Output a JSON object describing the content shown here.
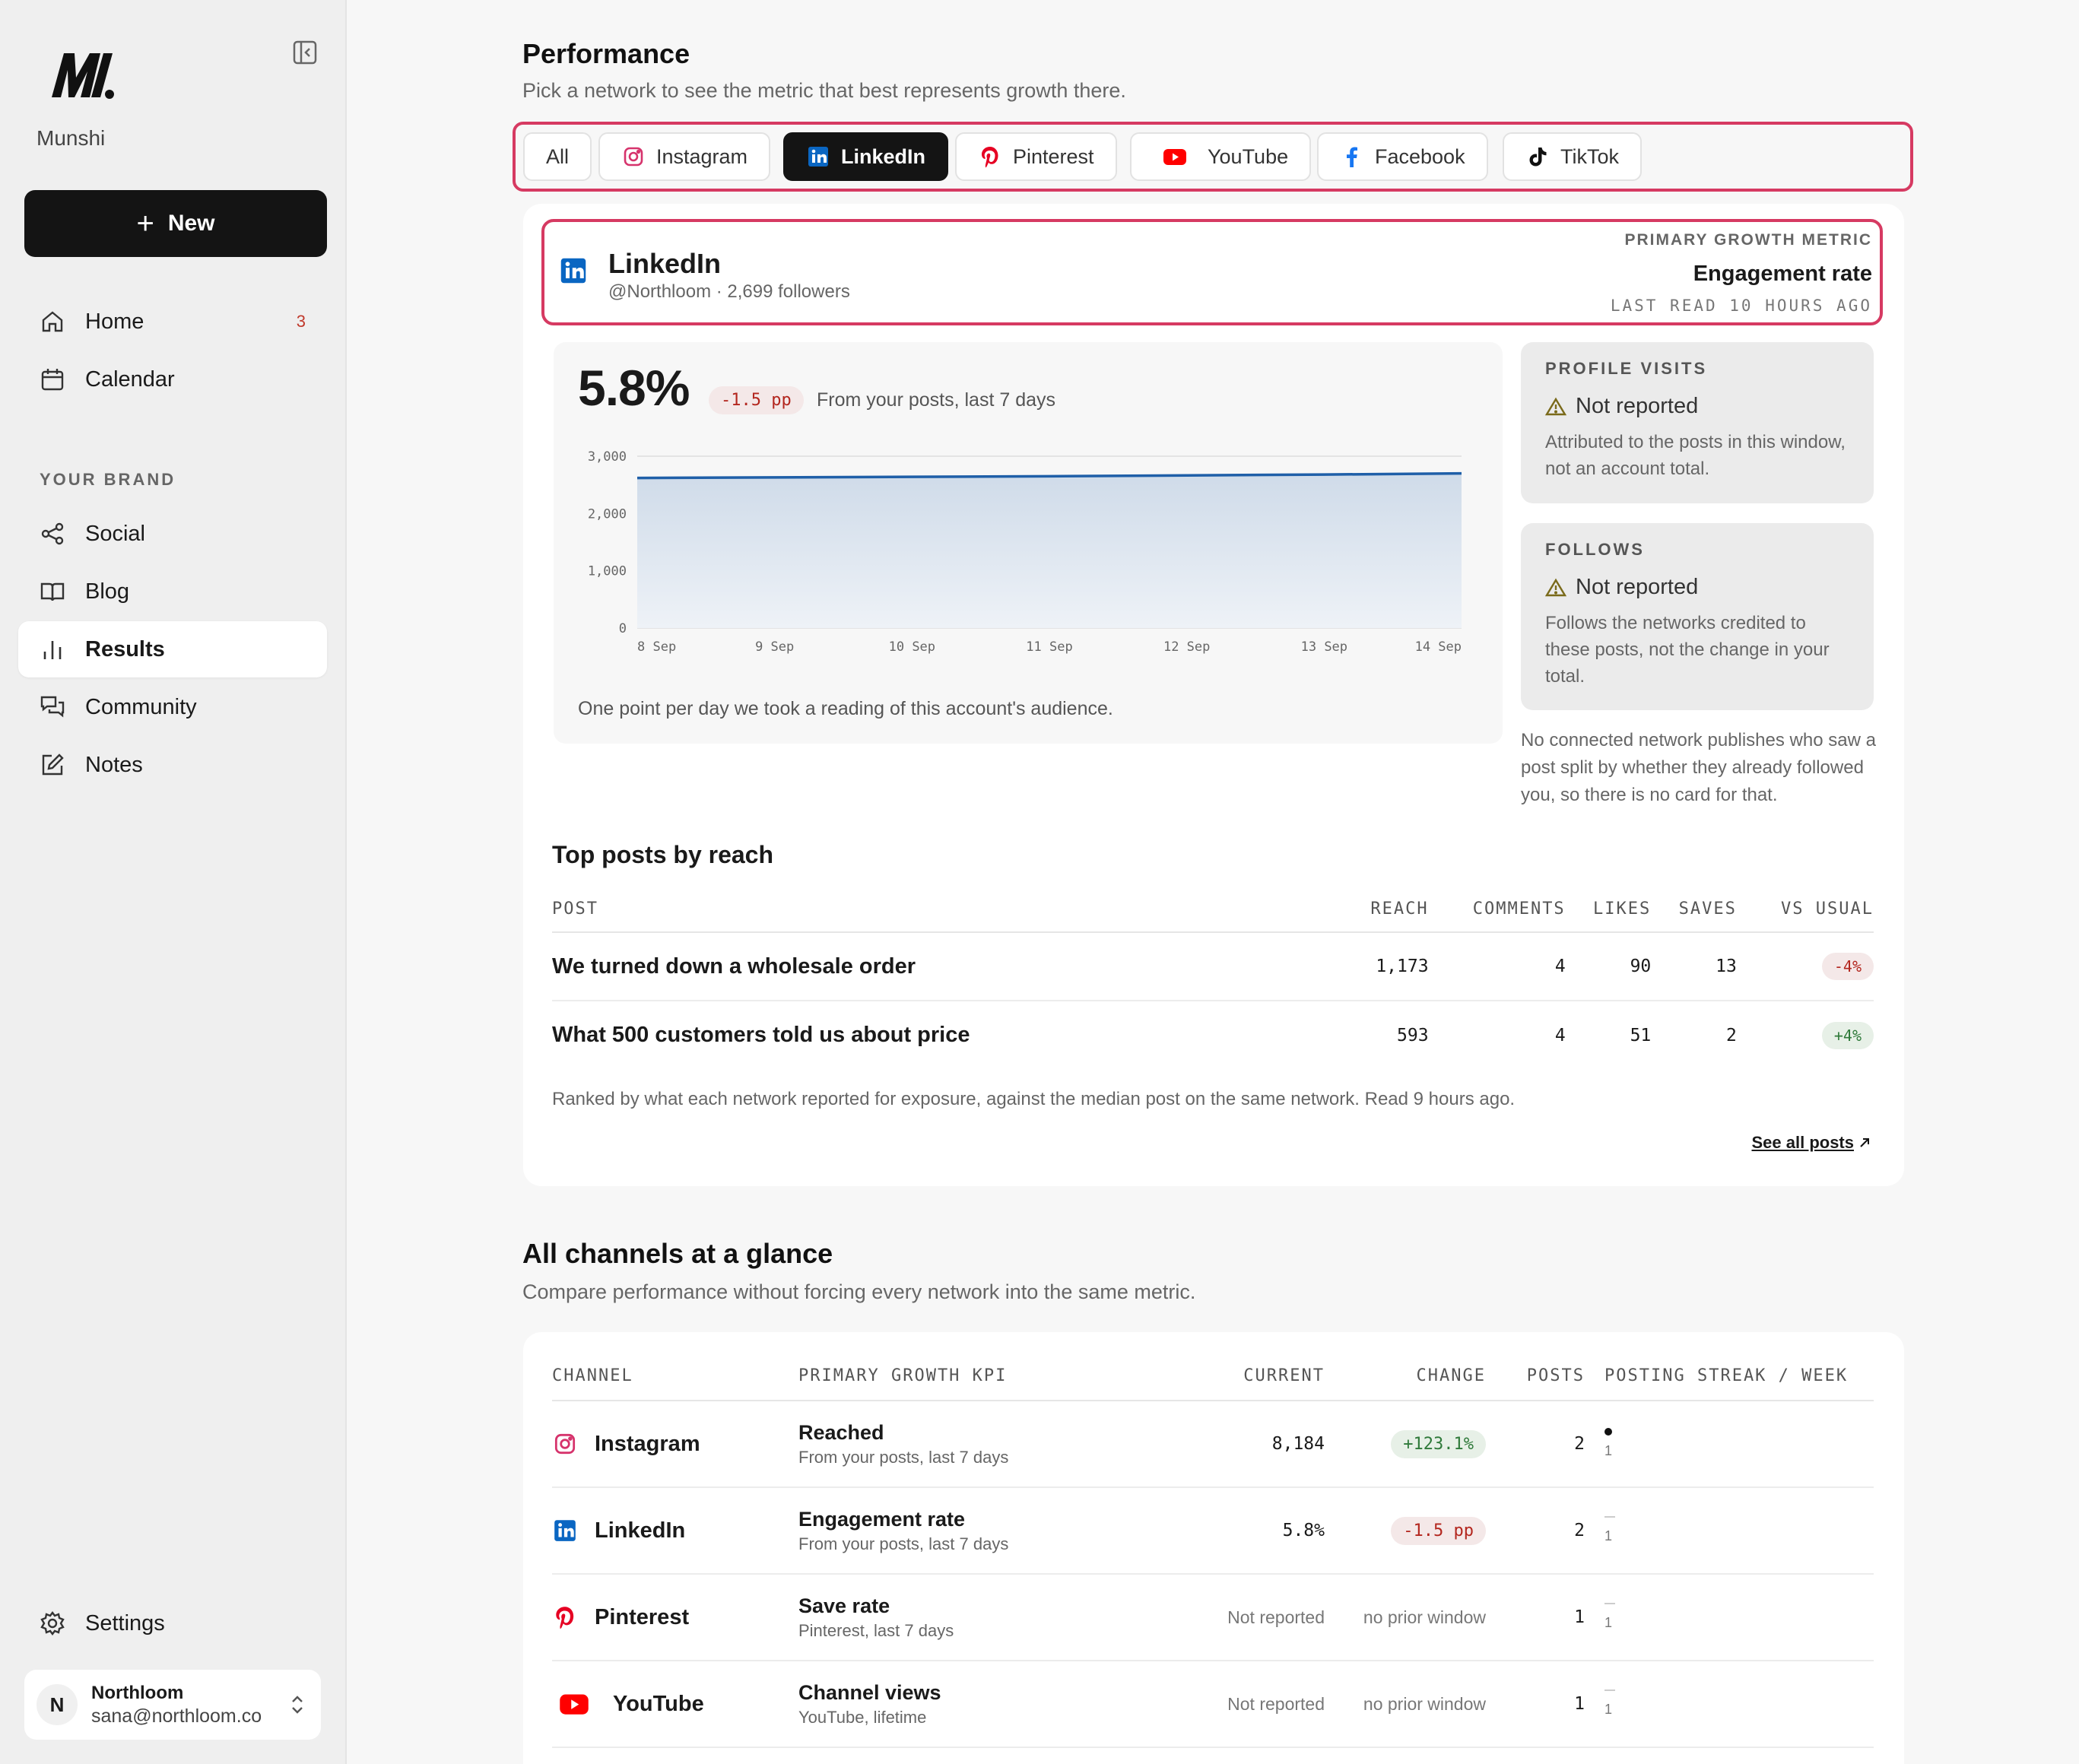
{
  "sidebar": {
    "brand": "Munshi",
    "new_label": "New",
    "nav": [
      {
        "label": "Home",
        "icon": "home-icon",
        "count": "3"
      },
      {
        "label": "Calendar",
        "icon": "calendar-icon"
      }
    ],
    "section_label": "YOUR BRAND",
    "brand_nav": [
      {
        "label": "Social",
        "icon": "share-icon"
      },
      {
        "label": "Blog",
        "icon": "book-icon"
      },
      {
        "label": "Results",
        "icon": "bar-chart-icon",
        "active": true
      },
      {
        "label": "Community",
        "icon": "chat-icon"
      },
      {
        "label": "Notes",
        "icon": "edit-icon"
      }
    ],
    "settings_label": "Settings",
    "account": {
      "initial": "N",
      "name": "Northloom",
      "email": "sana@northloom.co"
    }
  },
  "performance": {
    "title": "Performance",
    "subtitle": "Pick a network to see the metric that best represents growth there.",
    "tabs": [
      {
        "label": "All"
      },
      {
        "label": "Instagram",
        "icon": "instagram-icon"
      },
      {
        "label": "LinkedIn",
        "icon": "linkedin-icon",
        "active": true
      },
      {
        "label": "Pinterest",
        "icon": "pinterest-icon"
      },
      {
        "label": "YouTube",
        "icon": "youtube-icon"
      },
      {
        "label": "Facebook",
        "icon": "facebook-icon"
      },
      {
        "label": "TikTok",
        "icon": "tiktok-icon"
      }
    ],
    "network": {
      "name": "LinkedIn",
      "handle": "@Northloom · 2,699 followers",
      "metric_label": "PRIMARY GROWTH METRIC",
      "metric_name": "Engagement rate",
      "last_read": "LAST READ 10 HOURS AGO"
    },
    "headline": {
      "value": "5.8%",
      "change": "-1.5 pp",
      "caption": "From your posts, last 7 days",
      "footnote": "One point per day we took a reading of this account's audience."
    },
    "profile_visits": {
      "title": "PROFILE VISITS",
      "status": "Not reported",
      "desc": "Attributed to the posts in this window, not an account total."
    },
    "follows": {
      "title": "FOLLOWS",
      "status": "Not reported",
      "desc": "Follows the networks credited to these posts, not the change in your total."
    },
    "no_card_note": "No connected network publishes who saw a post split by whether they already followed you, so there is no card for that.",
    "top_posts": {
      "title": "Top posts by reach",
      "columns": [
        "POST",
        "REACH",
        "COMMENTS",
        "LIKES",
        "SAVES",
        "VS USUAL"
      ],
      "rows": [
        {
          "post": "We turned down a wholesale order",
          "reach": "1,173",
          "comments": "4",
          "likes": "90",
          "saves": "13",
          "vs": "-4%"
        },
        {
          "post": "What 500 customers told us about price",
          "reach": "593",
          "comments": "4",
          "likes": "51",
          "saves": "2",
          "vs": "+4%"
        }
      ],
      "note": "Ranked by what each network reported for exposure, against the median post on the same network. Read 9 hours ago.",
      "see_all": "See all posts"
    }
  },
  "chart_data": {
    "type": "area",
    "title": "",
    "xlabel": "",
    "ylabel": "",
    "x": [
      "8 Sep",
      "9 Sep",
      "10 Sep",
      "11 Sep",
      "12 Sep",
      "13 Sep",
      "14 Sep"
    ],
    "y": [
      2620,
      2630,
      2640,
      2650,
      2665,
      2680,
      2699
    ],
    "yticks": [
      "0",
      "1,000",
      "2,000",
      "3,000"
    ],
    "ylim": [
      0,
      3000
    ],
    "grid": true,
    "color": "#1f5fa8"
  },
  "channels": {
    "title": "All channels at a glance",
    "subtitle": "Compare performance without forcing every network into the same metric.",
    "columns": [
      "CHANNEL",
      "PRIMARY GROWTH KPI",
      "CURRENT",
      "CHANGE",
      "POSTS",
      "POSTING STREAK / WEEK"
    ],
    "rows": [
      {
        "channel": "Instagram",
        "icon": "instagram-icon",
        "kpi": "Reached",
        "kpi_sub": "From your posts, last 7 days",
        "current": "8,184",
        "change": "+123.1%",
        "change_type": "pos",
        "posts": "2",
        "streak": "1",
        "streak_active": true
      },
      {
        "channel": "LinkedIn",
        "icon": "linkedin-icon",
        "kpi": "Engagement rate",
        "kpi_sub": "From your posts, last 7 days",
        "current": "5.8%",
        "change": "-1.5 pp",
        "change_type": "neg",
        "posts": "2",
        "streak": "1",
        "streak_active": false
      },
      {
        "channel": "Pinterest",
        "icon": "pinterest-icon",
        "kpi": "Save rate",
        "kpi_sub": "Pinterest, last 7 days",
        "current": "Not reported",
        "change": "no prior window",
        "change_type": "none",
        "posts": "1",
        "streak": "1",
        "streak_active": false
      },
      {
        "channel": "YouTube",
        "icon": "youtube-icon",
        "kpi": "Channel views",
        "kpi_sub": "YouTube, lifetime",
        "current": "Not reported",
        "change": "no prior window",
        "change_type": "none",
        "posts": "1",
        "streak": "1",
        "streak_active": false
      }
    ]
  },
  "colors": {
    "accent_frame": "#d63a62",
    "linkedin": "#0a66c2",
    "pinterest": "#e60023",
    "youtube": "#ff0000",
    "instagram": "#d6336c",
    "facebook": "#1877f2"
  }
}
